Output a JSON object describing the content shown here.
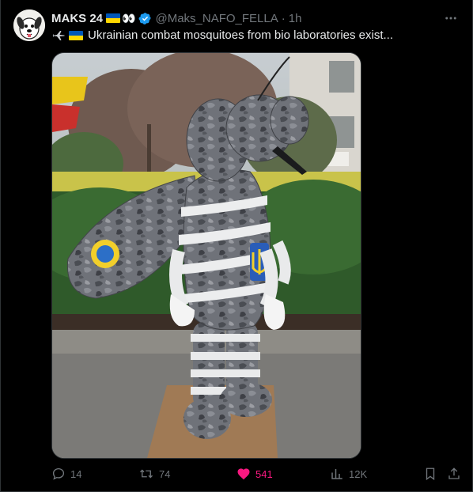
{
  "tweet": {
    "author_name": "MAKS 24",
    "author_emoji": "👀",
    "handle": "@Maks_NAFO_FELLA",
    "separator": "·",
    "time": "1h",
    "text": "Ukrainian combat mosquitoes from bio laboratories exist..."
  },
  "actions": {
    "replies": "14",
    "retweets": "74",
    "likes": "541",
    "views": "12K"
  },
  "icons": {
    "avatar": "cartoon-dog-avatar",
    "verified": "verified-badge-icon",
    "flag": "ukraine-flag-icon",
    "jet": "fighter-jet-icon",
    "more": "more-icon",
    "reply": "reply-icon",
    "retweet": "retweet-icon",
    "like": "heart-icon",
    "views": "views-icon",
    "bookmark": "bookmark-icon",
    "share": "share-icon"
  },
  "colors": {
    "background": "#000000",
    "text": "#e7e9ea",
    "muted": "#71767b",
    "like": "#f91880",
    "verified": "#1d9bf0",
    "flag_blue": "#0057b7",
    "flag_yellow": "#ffd700"
  }
}
